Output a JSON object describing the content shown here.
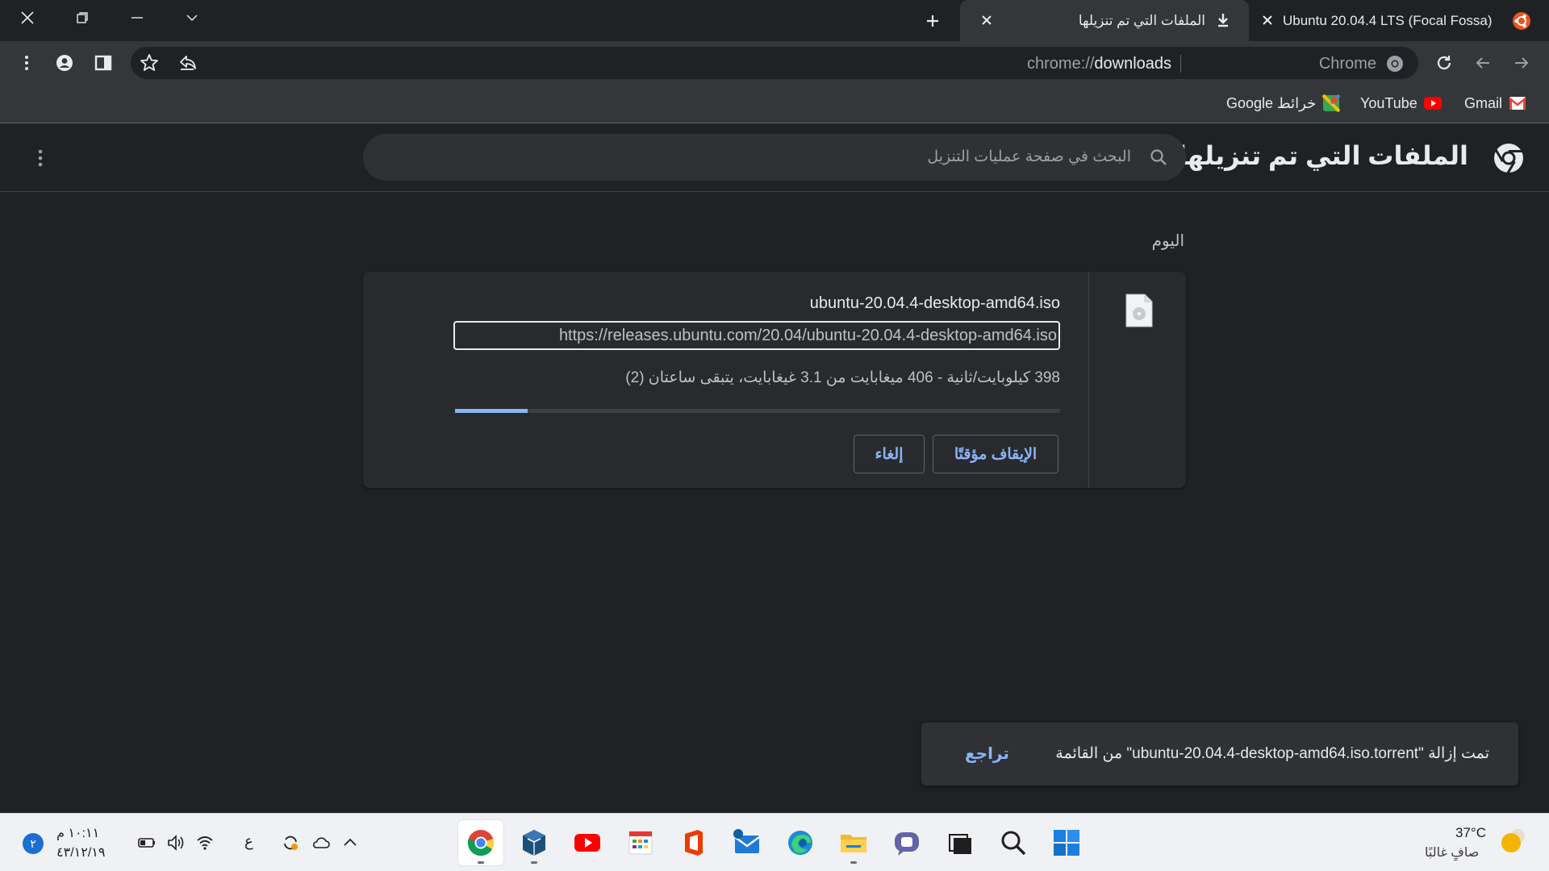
{
  "window_controls": {
    "close": "close",
    "restore": "restore",
    "minimize": "minimize",
    "tab_search": "tab-search"
  },
  "tabs": [
    {
      "title": "Ubuntu 20.04.4 LTS (Focal Fossa)",
      "icon": "ubuntu-icon",
      "active": false
    },
    {
      "title": "الملفات التي تم تنزيلها",
      "icon": "download-icon",
      "active": true
    }
  ],
  "toolbar": {
    "url_scheme": "chrome://",
    "url_host": "downloads",
    "chrome_label": "Chrome"
  },
  "bookmarks": [
    {
      "label": "Gmail",
      "icon": "gmail-icon"
    },
    {
      "label": "YouTube",
      "icon": "youtube-icon"
    },
    {
      "label": "خرائط Google",
      "icon": "maps-icon"
    }
  ],
  "page": {
    "title": "الملفات التي تم تنزيلها",
    "search_placeholder": "البحث في صفحة عمليات التنزيل"
  },
  "section_label": "اليوم",
  "download": {
    "file_name": "ubuntu-20.04.4-desktop-amd64.iso",
    "url": "https://releases.ubuntu.com/20.04/ubuntu-20.04.4-desktop-amd64.iso",
    "status": "398 كيلوبايت/ثانية - 406 ميغابايت من 3.1 غيغابايت، يتبقى ساعتان (2)",
    "progress_fraction": 0.12,
    "pause_label": "الإيقاف مؤقتًا",
    "cancel_label": "إلغاء"
  },
  "toast": {
    "message": "تمت إزالة \"ubuntu-20.04.4-desktop-amd64.iso.torrent\" من القائمة",
    "undo_label": "تراجع"
  },
  "taskbar": {
    "weather_temp": "37°C",
    "weather_desc": "صافٍ غالبًا",
    "clock_time": "١٠:١١ م",
    "clock_date": "٤٣/١٢/١٩",
    "language": "ع",
    "notification_count": "٢",
    "apps": [
      "windows-start",
      "search",
      "task-view",
      "chat",
      "file-explorer",
      "edge",
      "mail",
      "office",
      "calendar-app",
      "youtube-app",
      "virtualbox",
      "chrome"
    ]
  },
  "colors": {
    "accent": "#8ab4f8",
    "page_bg": "#202124",
    "toolbar_bg": "#35363a",
    "card_bg": "#292a2d"
  }
}
